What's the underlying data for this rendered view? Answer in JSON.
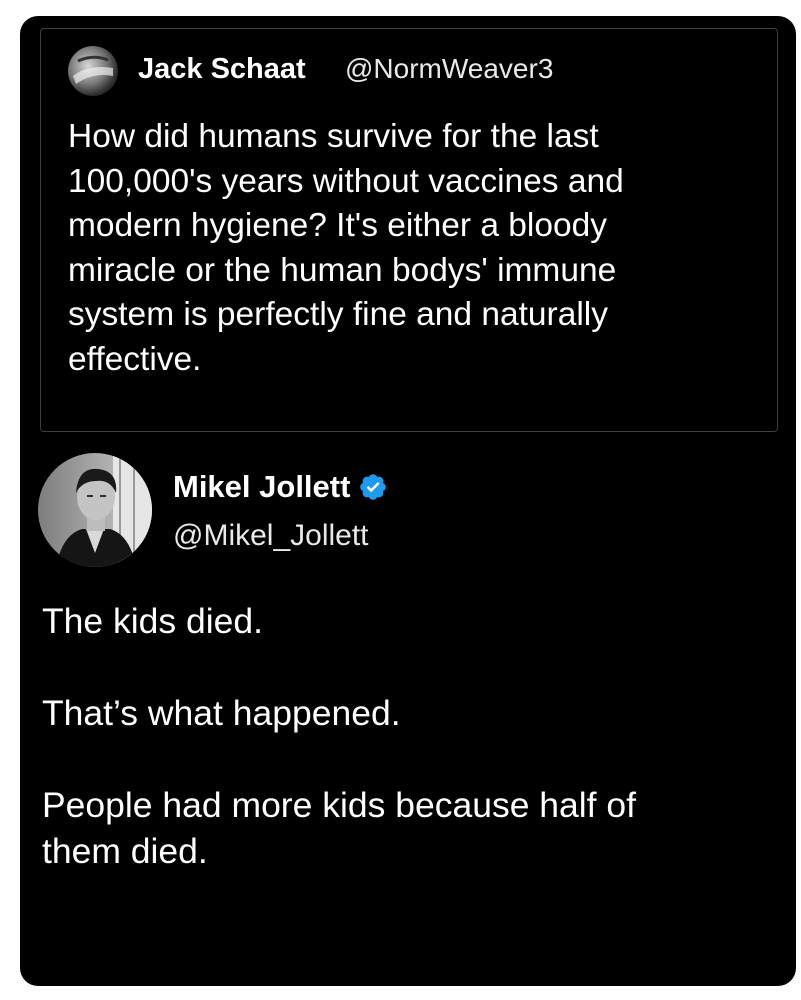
{
  "quoted_tweet": {
    "author_name": "Jack Schaat",
    "author_handle": "@NormWeaver3",
    "text_lines": [
      "How did humans survive for the last",
      "100,000's years without vaccines and",
      "modern hygiene? It's either a bloody",
      "miracle or the human bodys' immune",
      "system is perfectly fine and naturally",
      "effective."
    ]
  },
  "reply_tweet": {
    "author_name": "Mikel Jollett",
    "author_handle": "@Mikel_Jollett",
    "verified": true,
    "paragraphs": [
      [
        "The kids died."
      ],
      [
        "That’s what happened."
      ],
      [
        "People had more kids because half of",
        "them died."
      ]
    ]
  },
  "colors": {
    "background": "#000000",
    "text": "#ffffff",
    "verified_badge": "#1d9bf0",
    "quote_border": "#3a3f44"
  },
  "icons": {
    "verified": "verified-badge-icon"
  }
}
